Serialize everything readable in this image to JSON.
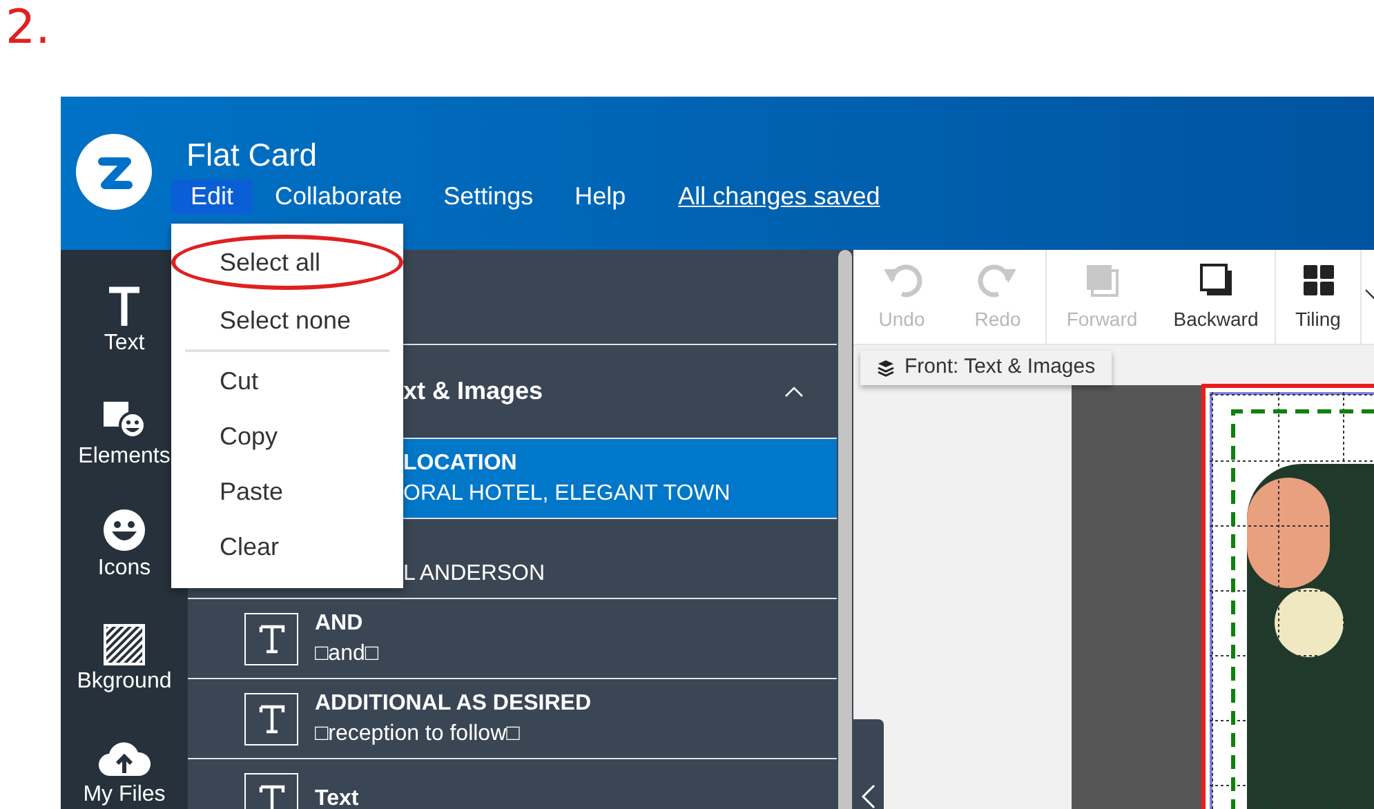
{
  "annotation": {
    "label": "2."
  },
  "header": {
    "title": "Flat Card",
    "menu": [
      {
        "label": "Edit",
        "selected": true
      },
      {
        "label": "Collaborate",
        "selected": false
      },
      {
        "label": "Settings",
        "selected": false
      },
      {
        "label": "Help",
        "selected": false
      }
    ],
    "save_status": "All changes saved"
  },
  "edit_menu": {
    "items": [
      {
        "kind": "item",
        "label": "Select all",
        "circled": true
      },
      {
        "kind": "item",
        "label": "Select none",
        "circled": false
      },
      {
        "kind": "separator"
      },
      {
        "kind": "item",
        "label": "Cut",
        "circled": false
      },
      {
        "kind": "item",
        "label": "Copy",
        "circled": false
      },
      {
        "kind": "item",
        "label": "Paste",
        "circled": false
      },
      {
        "kind": "item",
        "label": "Clear",
        "circled": false
      }
    ]
  },
  "rail": {
    "items": [
      {
        "kind": "text",
        "label": "Text"
      },
      {
        "kind": "elements",
        "label": "Elements"
      },
      {
        "kind": "icons",
        "label": "Icons"
      },
      {
        "kind": "background",
        "label": "Bkground"
      },
      {
        "kind": "files",
        "label": "My Files"
      }
    ]
  },
  "layers": {
    "section": {
      "title": "xt & Images",
      "expanded": true
    },
    "rows": [
      {
        "covered": true,
        "title": "LOCATION",
        "text": "ORAL HOTEL, ELEGANT TOWN",
        "selected": true
      },
      {
        "covered": true,
        "text": "L ANDERSON",
        "selected": false
      },
      {
        "covered": false,
        "title": "AND",
        "text": "□and□",
        "selected": false
      },
      {
        "covered": false,
        "title": "ADDITIONAL AS DESIRED",
        "text": "□reception to follow□",
        "selected": false
      },
      {
        "covered": false,
        "title": "Text",
        "selected": false
      }
    ]
  },
  "toolbar": {
    "buttons": [
      {
        "kind": "undo",
        "label": "Undo",
        "disabled": true
      },
      {
        "kind": "redo",
        "label": "Redo",
        "disabled": true
      },
      {
        "kind": "forward",
        "label": "Forward",
        "disabled": true
      },
      {
        "kind": "backward",
        "label": "Backward",
        "disabled": false
      },
      {
        "kind": "tiling",
        "label": "Tiling",
        "disabled": false
      }
    ]
  },
  "canvas": {
    "side_tab": "Front: Text & Images"
  }
}
